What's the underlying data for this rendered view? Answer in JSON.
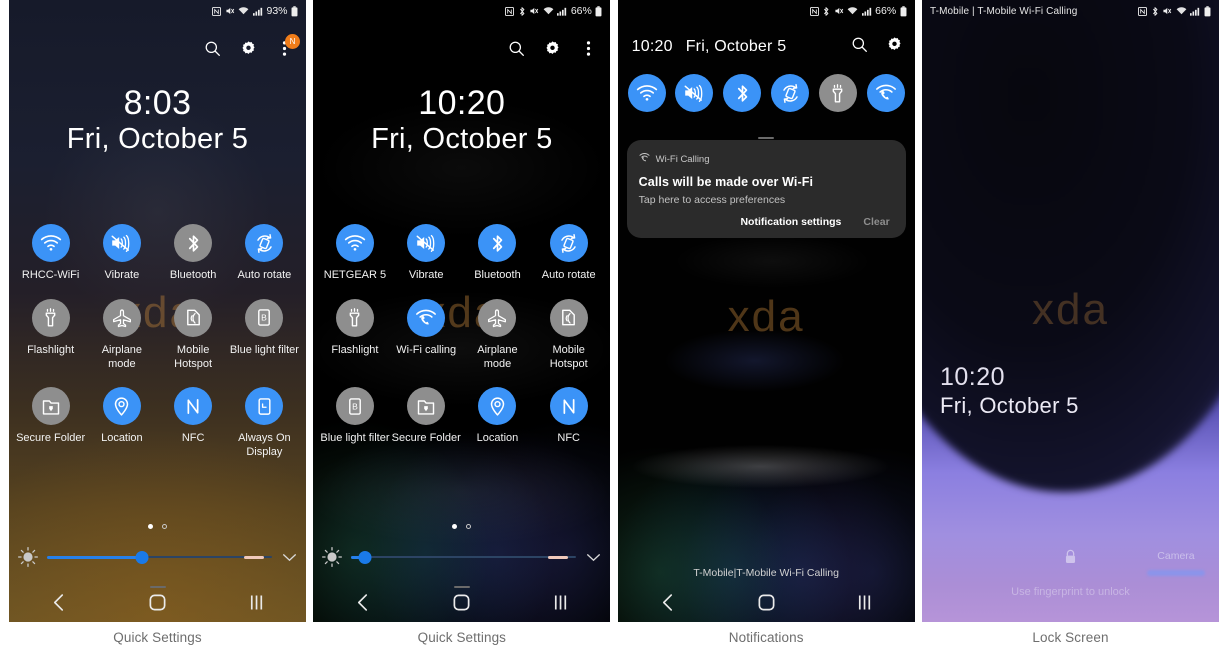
{
  "panels": [
    {
      "caption": "Quick Settings",
      "kind": "quick-settings",
      "status_bar": {
        "left_text": "",
        "battery": "93%",
        "icons": [
          "nfc-icon",
          "mute-icon",
          "wifi-icon",
          "signal-icon",
          "battery-icon"
        ]
      },
      "header_actions": [
        "search-icon",
        "gear-icon",
        "more-icon"
      ],
      "badge": "N",
      "clock": {
        "time": "8:03",
        "date": "Fri, October 5"
      },
      "watermark": "xda",
      "tiles": [
        {
          "label": "RHCC-WiFi",
          "icon": "wifi-icon",
          "state": "on"
        },
        {
          "label": "Vibrate",
          "icon": "vibrate-icon",
          "state": "on"
        },
        {
          "label": "Bluetooth",
          "icon": "bluetooth-icon",
          "state": "off"
        },
        {
          "label": "Auto rotate",
          "icon": "auto-rotate-icon",
          "state": "on"
        },
        {
          "label": "Flashlight",
          "icon": "flashlight-icon",
          "state": "off"
        },
        {
          "label": "Airplane mode",
          "icon": "airplane-icon",
          "state": "off"
        },
        {
          "label": "Mobile Hotspot",
          "icon": "hotspot-icon",
          "state": "off"
        },
        {
          "label": "Blue light filter",
          "icon": "blue-light-icon",
          "state": "off"
        },
        {
          "label": "Secure Folder",
          "icon": "secure-folder-icon",
          "state": "off"
        },
        {
          "label": "Location",
          "icon": "location-icon",
          "state": "on"
        },
        {
          "label": "NFC",
          "icon": "nfc-icon",
          "state": "on"
        },
        {
          "label": "Always On Display",
          "icon": "always-on-display-icon",
          "state": "on"
        }
      ],
      "pager": {
        "pages": 2,
        "current": 1
      },
      "brightness": {
        "percent": 42
      },
      "navbar": [
        "back-icon",
        "home-icon",
        "recents-icon"
      ]
    },
    {
      "caption": "Quick Settings",
      "kind": "quick-settings",
      "status_bar": {
        "left_text": "",
        "battery": "66%",
        "icons": [
          "nfc-icon",
          "bluetooth-icon",
          "mute-icon",
          "wifi-icon",
          "signal-icon",
          "battery-icon"
        ]
      },
      "header_actions": [
        "search-icon",
        "gear-icon",
        "more-icon"
      ],
      "badge": "",
      "clock": {
        "time": "10:20",
        "date": "Fri, October 5"
      },
      "watermark": "xda",
      "tiles": [
        {
          "label": "NETGEAR 5",
          "icon": "wifi-icon",
          "state": "on"
        },
        {
          "label": "Vibrate",
          "icon": "vibrate-icon",
          "state": "on"
        },
        {
          "label": "Bluetooth",
          "icon": "bluetooth-icon",
          "state": "on"
        },
        {
          "label": "Auto rotate",
          "icon": "auto-rotate-icon",
          "state": "on"
        },
        {
          "label": "Flashlight",
          "icon": "flashlight-icon",
          "state": "off"
        },
        {
          "label": "Wi-Fi calling",
          "icon": "wifi-calling-icon",
          "state": "on"
        },
        {
          "label": "Airplane mode",
          "icon": "airplane-icon",
          "state": "off"
        },
        {
          "label": "Mobile Hotspot",
          "icon": "hotspot-icon",
          "state": "off"
        },
        {
          "label": "Blue light filter",
          "icon": "blue-light-icon",
          "state": "off"
        },
        {
          "label": "Secure Folder",
          "icon": "secure-folder-icon",
          "state": "off"
        },
        {
          "label": "Location",
          "icon": "location-icon",
          "state": "on"
        },
        {
          "label": "NFC",
          "icon": "nfc-icon",
          "state": "on"
        }
      ],
      "pager": {
        "pages": 2,
        "current": 1
      },
      "brightness": {
        "percent": 6
      },
      "navbar": [
        "back-icon",
        "home-icon",
        "recents-icon"
      ]
    },
    {
      "caption": "Notifications",
      "kind": "notifications",
      "status_bar": {
        "left_text": "",
        "battery": "66%",
        "icons": [
          "nfc-icon",
          "bluetooth-icon",
          "mute-icon",
          "wifi-icon",
          "signal-icon",
          "battery-icon"
        ]
      },
      "header": {
        "time": "10:20",
        "date": "Fri, October 5",
        "actions": [
          "search-icon",
          "gear-icon"
        ]
      },
      "quick_tiles": [
        {
          "icon": "wifi-icon",
          "state": "on"
        },
        {
          "icon": "vibrate-icon",
          "state": "on"
        },
        {
          "icon": "bluetooth-icon",
          "state": "on"
        },
        {
          "icon": "auto-rotate-icon",
          "state": "on"
        },
        {
          "icon": "flashlight-icon",
          "state": "off"
        },
        {
          "icon": "wifi-calling-icon",
          "state": "on"
        }
      ],
      "notification": {
        "app_icon": "wifi-calling-icon",
        "app": "Wi-Fi Calling",
        "title": "Calls will be made over Wi-Fi",
        "body": "Tap here to access preferences",
        "settings_label": "Notification settings",
        "clear_label": "Clear"
      },
      "watermark": "xda",
      "carrier_note": "T-Mobile|T-Mobile Wi-Fi Calling",
      "navbar": [
        "back-icon",
        "home-icon",
        "recents-icon"
      ]
    },
    {
      "caption": "Lock Screen",
      "kind": "lock-screen",
      "status_bar": {
        "left_text": "T-Mobile | T-Mobile Wi-Fi Calling",
        "battery": "",
        "icons": [
          "nfc-icon",
          "bluetooth-icon",
          "mute-icon",
          "wifi-icon",
          "signal-icon",
          "battery-icon"
        ]
      },
      "clock": {
        "time": "10:20",
        "date": "Fri, October 5"
      },
      "watermark": "xda",
      "lock_icon": "lock-icon",
      "hint": "Use fingerprint to unlock",
      "camera_label": "Camera"
    }
  ],
  "colors": {
    "accent_on": "#3b93f7",
    "tile_off": "#8e8e8e",
    "badge": "#f07d1a",
    "caption_text": "#6e6e6e",
    "slider_fill": "#2680eb"
  }
}
